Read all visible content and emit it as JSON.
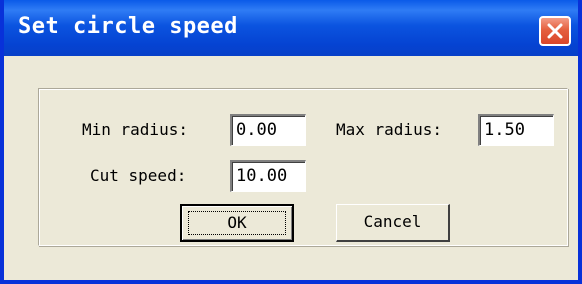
{
  "window": {
    "title": "Set circle speed"
  },
  "form": {
    "min_radius_label": "Min radius:",
    "min_radius_value": "0.00",
    "max_radius_label": "Max radius:",
    "max_radius_value": "1.50",
    "cut_speed_label": "Cut speed:",
    "cut_speed_value": "10.00"
  },
  "buttons": {
    "ok_label": "OK",
    "cancel_label": "Cancel"
  },
  "icons": {
    "close": "close-icon"
  },
  "colors": {
    "titlebar": "#0543d2",
    "window_bg": "#ece9d8",
    "close_button": "#d9452a"
  }
}
